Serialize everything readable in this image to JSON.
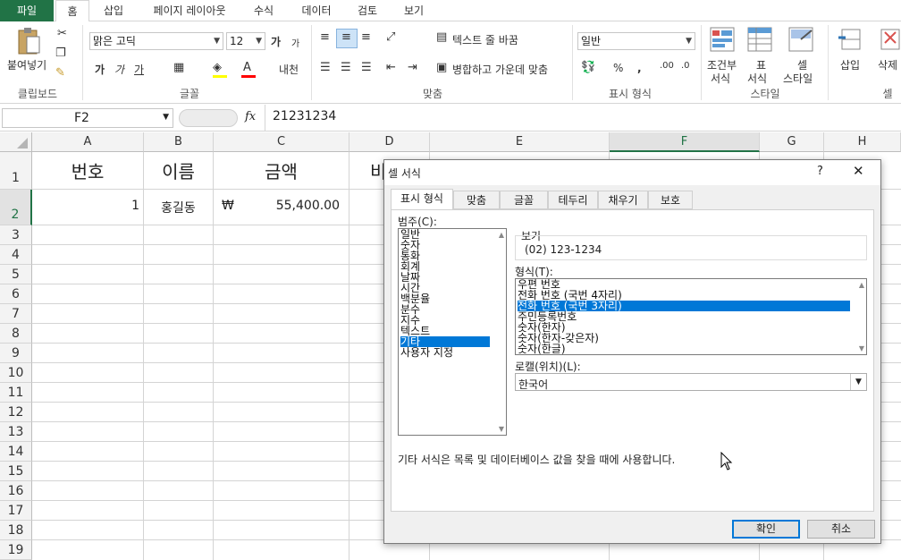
{
  "ribbon": {
    "tabs": [
      "파일",
      "홈",
      "삽입",
      "페이지 레이아웃",
      "수식",
      "데이터",
      "검토",
      "보기"
    ],
    "clipboard": {
      "paste": "붙여넣기",
      "label": "클립보드"
    },
    "font": {
      "name": "맑은 고딕",
      "size": "12",
      "bold": "가",
      "italic": "가",
      "underline": "가",
      "grow": "가",
      "shrink": "가",
      "phonetic": "내천",
      "label": "글꼴"
    },
    "align": {
      "wrap": "텍스트 줄 바꿈",
      "merge": "병합하고 가운데 맞춤",
      "label": "맞춤"
    },
    "number": {
      "format": "일반",
      "percent": "%",
      "comma": ",",
      "label": "표시 형식"
    },
    "styles": {
      "cond": "조건부",
      "cond2": "서식",
      "table": "표",
      "table2": "서식",
      "cell": "셀",
      "cell2": "스타일",
      "label": "스타일"
    },
    "cells": {
      "insert": "삽입",
      "delete": "삭제",
      "label": "셀"
    }
  },
  "formula_bar": {
    "name_box": "F2",
    "fx": "fx",
    "value": "21231234"
  },
  "sheet": {
    "columns": [
      "A",
      "B",
      "C",
      "D",
      "E",
      "F",
      "G",
      "H"
    ],
    "rows": [
      "1",
      "2",
      "3",
      "4",
      "5",
      "6",
      "7",
      "8",
      "9",
      "10",
      "11",
      "12",
      "13",
      "14",
      "15",
      "16",
      "17",
      "18",
      "19"
    ],
    "header_row": {
      "a": "번호",
      "b": "이름",
      "c": "금액",
      "d": "비"
    },
    "data_row": {
      "a": "1",
      "b": "홍길동",
      "c_symbol": "₩",
      "c_value": "55,400.00"
    }
  },
  "dialog": {
    "title": "셀 서식",
    "help": "?",
    "close": "✕",
    "tabs": [
      "표시 형식",
      "맞춤",
      "글꼴",
      "테두리",
      "채우기",
      "보호"
    ],
    "category_label": "범주(C):",
    "categories": [
      "일반",
      "숫자",
      "통화",
      "회계",
      "날짜",
      "시간",
      "백분율",
      "분수",
      "지수",
      "텍스트",
      "기타",
      "사용자 지정"
    ],
    "selected_category": "기타",
    "preview_label": "보기",
    "preview_value": "(02) 123-1234",
    "type_label": "형식(T):",
    "types": [
      "우편 번호",
      "전화 번호 (국번 4자리)",
      "전화 번호 (국번 3자리)",
      "주민등록번호",
      "숫자(한자)",
      "숫자(한자-갖은자)",
      "숫자(한글)"
    ],
    "selected_type": "전화 번호 (국번 3자리)",
    "locale_label": "로캘(위치)(L):",
    "locale_value": "한국어",
    "description": "기타 서식은 목록 및 데이터베이스 값을 찾을 때에 사용합니다.",
    "ok": "확인",
    "cancel": "취소"
  },
  "colors": {
    "excel_green": "#217346",
    "selection_blue": "#0078d7"
  }
}
